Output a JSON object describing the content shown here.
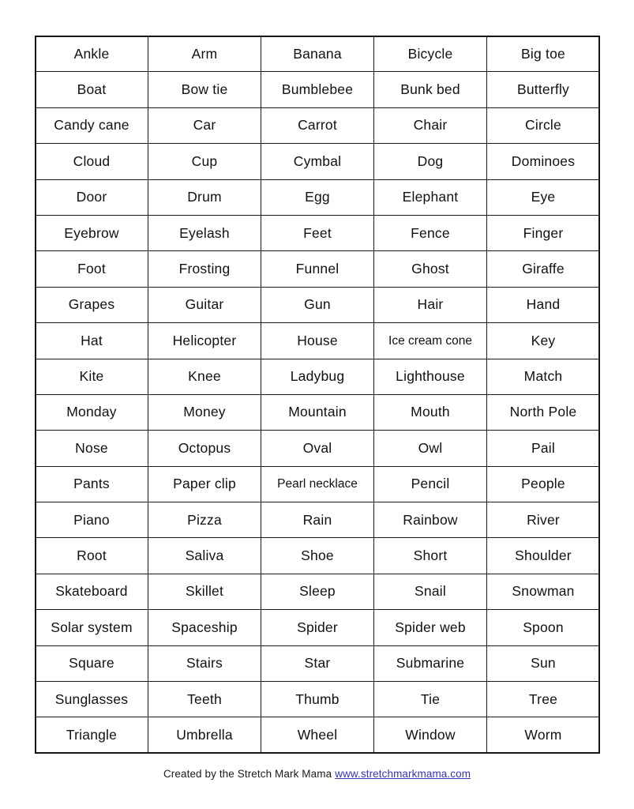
{
  "document": {
    "type": "word-list-worksheet",
    "columns": 5,
    "rows": 20,
    "border_color": "#141414",
    "link_color": "#3333bb"
  },
  "table": {
    "rows": [
      [
        "Ankle",
        "Arm",
        "Banana",
        "Bicycle",
        "Big toe"
      ],
      [
        "Boat",
        "Bow tie",
        "Bumblebee",
        "Bunk bed",
        "Butterfly"
      ],
      [
        "Candy cane",
        "Car",
        "Carrot",
        "Chair",
        "Circle"
      ],
      [
        "Cloud",
        "Cup",
        "Cymbal",
        "Dog",
        "Dominoes"
      ],
      [
        "Door",
        "Drum",
        "Egg",
        "Elephant",
        "Eye"
      ],
      [
        "Eyebrow",
        "Eyelash",
        "Feet",
        "Fence",
        "Finger"
      ],
      [
        "Foot",
        "Frosting",
        "Funnel",
        "Ghost",
        "Giraffe"
      ],
      [
        "Grapes",
        "Guitar",
        "Gun",
        "Hair",
        "Hand"
      ],
      [
        "Hat",
        "Helicopter",
        "House",
        "Ice cream cone",
        "Key"
      ],
      [
        "Kite",
        "Knee",
        "Ladybug",
        "Lighthouse",
        "Match"
      ],
      [
        "Monday",
        "Money",
        "Mountain",
        "Mouth",
        "North Pole"
      ],
      [
        "Nose",
        "Octopus",
        "Oval",
        "Owl",
        "Pail"
      ],
      [
        "Pants",
        "Paper clip",
        "Pearl necklace",
        "Pencil",
        "People"
      ],
      [
        "Piano",
        "Pizza",
        "Rain",
        "Rainbow",
        "River"
      ],
      [
        "Root",
        "Saliva",
        "Shoe",
        "Short",
        "Shoulder"
      ],
      [
        "Skateboard",
        "Skillet",
        "Sleep",
        "Snail",
        "Snowman"
      ],
      [
        "Solar system",
        "Spaceship",
        "Spider",
        "Spider web",
        "Spoon"
      ],
      [
        "Square",
        "Stairs",
        "Star",
        "Submarine",
        "Sun"
      ],
      [
        "Sunglasses",
        "Teeth",
        "Thumb",
        "Tie",
        "Tree"
      ],
      [
        "Triangle",
        "Umbrella",
        "Wheel",
        "Window",
        "Worm"
      ]
    ]
  },
  "footer": {
    "credit": "Created by the Stretch Mark Mama",
    "link": "www.stretchmarkmama.com"
  }
}
